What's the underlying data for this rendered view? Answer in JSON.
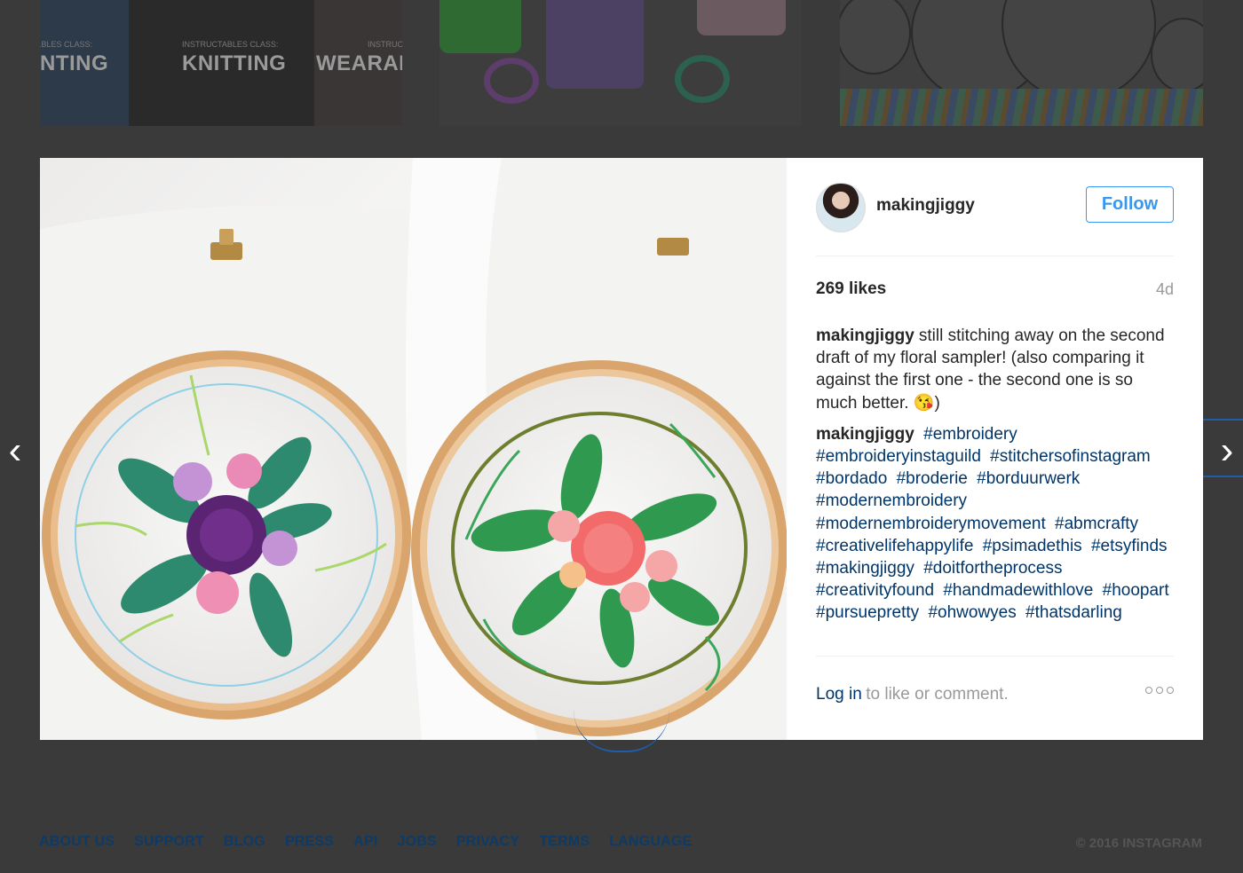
{
  "thumbnails": {
    "left_tiles": [
      {
        "subtitle": "...BLES CLASS:",
        "title": "NTING"
      },
      {
        "subtitle": "INSTRUCTABLES CLASS:",
        "title": "KNITTING"
      },
      {
        "subtitle": "INSTRUCT",
        "title": "WEARABLE E"
      }
    ]
  },
  "post": {
    "username": "makingjiggy",
    "follow_label": "Follow",
    "likes": "269 likes",
    "age": "4d",
    "caption_user": "makingjiggy",
    "caption_text": "still stitching away on the second draft of my floral sampler! (also comparing it against the first one - the second one is so much better. 😘)",
    "comment_user": "makingjiggy",
    "hashtags": [
      "#embroidery",
      "#embroideryinstaguild",
      "#stitchersofinstagram",
      "#bordado",
      "#broderie",
      "#borduurwerk",
      "#modernembroidery",
      "#modernembroiderymovement",
      "#abmcrafty",
      "#creativelifehappylife",
      "#psimadethis",
      "#etsyfinds",
      "#makingjiggy",
      "#doitfortheprocess",
      "#creativityfound",
      "#handmadewithlove",
      "#hoopart",
      "#pursuepretty",
      "#ohwowyes",
      "#thatsdarling"
    ],
    "login_link": "Log in",
    "login_rest": "to like or comment."
  },
  "nav": {
    "prev_arrow": "‹",
    "next_arrow": "›"
  },
  "footer": {
    "links": [
      "ABOUT US",
      "SUPPORT",
      "BLOG",
      "PRESS",
      "API",
      "JOBS",
      "PRIVACY",
      "TERMS",
      "LANGUAGE"
    ],
    "copyright": "© 2016 INSTAGRAM"
  },
  "colors": {
    "accent": "#3897f0",
    "link": "#003569",
    "overlay": "#3a3a3a"
  }
}
